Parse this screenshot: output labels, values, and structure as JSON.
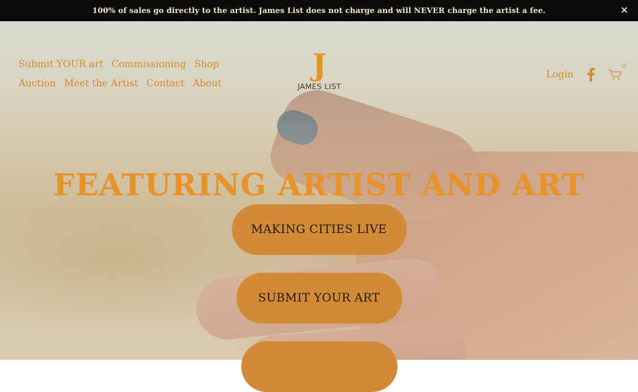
{
  "announcement": {
    "text": "100% of sales go directly to the artist. James List does not charge and will NEVER charge the artist a fee.",
    "close_label": "×"
  },
  "header": {
    "nav_row1": [
      "Submit YOUR art",
      "Commissioning",
      "Shop"
    ],
    "nav_row2": [
      "Auction",
      "Meet the Artist",
      "Contact",
      "About"
    ],
    "logo_mark": "J",
    "logo_name": "JAMES LIST",
    "login_label": "Login",
    "cart_count": "0",
    "icons": {
      "facebook": "facebook-icon",
      "cart": "cart-icon",
      "close": "close-icon"
    }
  },
  "hero": {
    "headline": "Featuring Artist and Art",
    "buttons": [
      "Making Cities Live",
      "Submit your Art",
      ""
    ]
  },
  "colors": {
    "accent": "#e8922a",
    "nav_text": "#d4892b",
    "button_bg": "#d38a36",
    "announcement_bg": "#0b0b0b"
  }
}
